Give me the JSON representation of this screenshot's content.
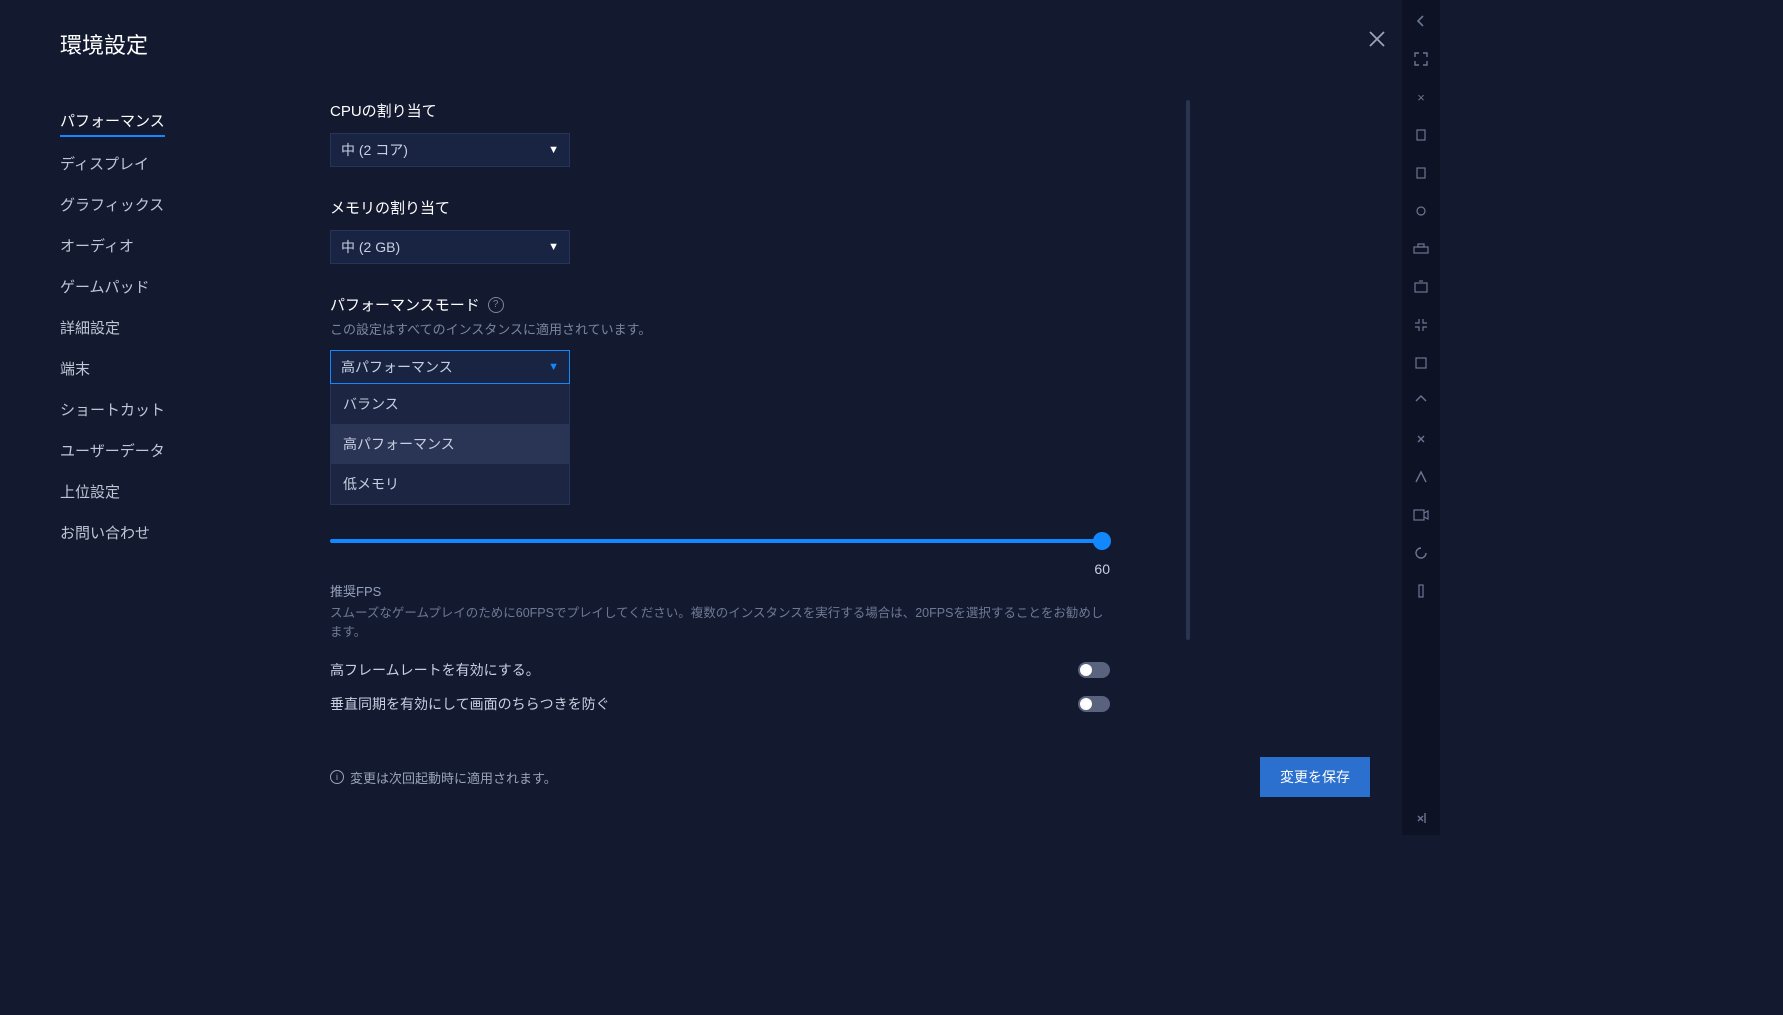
{
  "title": "環境設定",
  "sidebar": {
    "items": [
      {
        "label": "パフォーマンス",
        "active": true
      },
      {
        "label": "ディスプレイ"
      },
      {
        "label": "グラフィックス"
      },
      {
        "label": "オーディオ"
      },
      {
        "label": "ゲームパッド"
      },
      {
        "label": "詳細設定"
      },
      {
        "label": "端末"
      },
      {
        "label": "ショートカット"
      },
      {
        "label": "ユーザーデータ"
      },
      {
        "label": "上位設定"
      },
      {
        "label": "お問い合わせ"
      }
    ]
  },
  "cpu": {
    "label": "CPUの割り当て",
    "value": "中 (2 コア)"
  },
  "memory": {
    "label": "メモリの割り当て",
    "value": "中 (2 GB)"
  },
  "perf_mode": {
    "label": "パフォーマンスモード",
    "note": "この設定はすべてのインスタンスに適用されています。",
    "value": "高パフォーマンス",
    "options": [
      "バランス",
      "高パフォーマンス",
      "低メモリ"
    ]
  },
  "fps": {
    "value": "60",
    "rec_label": "推奨FPS",
    "help": "スムーズなゲームプレイのために60FPSでプレイしてください。複数のインスタンスを実行する場合は、20FPSを選択することをお勧めします。"
  },
  "toggles": {
    "high_fps": "高フレームレートを有効にする。",
    "vsync": "垂直同期を有効にして画面のちらつきを防ぐ"
  },
  "footer": {
    "note": "変更は次回起動時に適用されます。",
    "save": "変更を保存"
  }
}
